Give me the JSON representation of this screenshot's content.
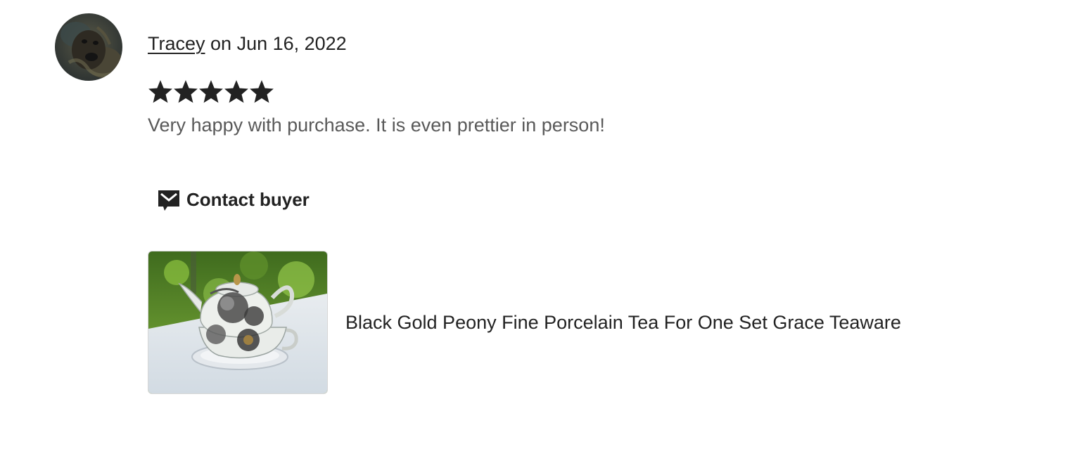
{
  "review": {
    "reviewer_name": "Tracey",
    "date_text": "on Jun 16, 2022",
    "rating": 5,
    "rating_max": 5,
    "text": "Very happy with purchase. It is even prettier in person!"
  },
  "actions": {
    "contact_buyer_label": "Contact buyer"
  },
  "listing": {
    "title": "Black Gold Peony Fine Porcelain Tea For One Set Grace Teaware"
  },
  "icons": {
    "star": "star-icon",
    "contact": "mail-icon"
  },
  "colors": {
    "text_primary": "#222222",
    "text_secondary": "#595959",
    "star": "#222222"
  }
}
